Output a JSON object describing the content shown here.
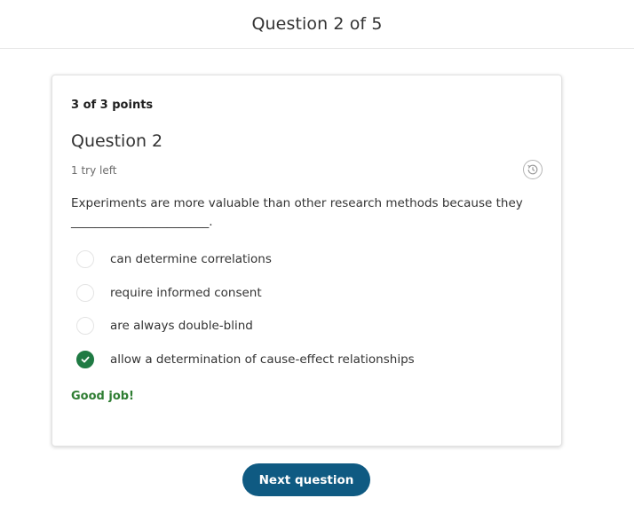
{
  "header": {
    "title": "Question 2 of 5"
  },
  "card": {
    "points": "3 of 3 points",
    "question_title": "Question 2",
    "tries_left": "1 try left",
    "history_icon": "history-icon",
    "prompt_line1": "Experiments are more valuable than other research methods because they",
    "prompt_line2": "_______________________.",
    "choices": [
      {
        "label": "can determine correlations",
        "selected": false
      },
      {
        "label": "require informed consent",
        "selected": false
      },
      {
        "label": "are always double-blind",
        "selected": false
      },
      {
        "label": "allow a determination of cause-effect relationships",
        "selected": true,
        "correct": true
      }
    ],
    "feedback": "Good job!"
  },
  "footer": {
    "next_label": "Next question"
  },
  "colors": {
    "accent": "#0f5a82",
    "correct": "#1f7a43",
    "feedback": "#2e7d32"
  }
}
